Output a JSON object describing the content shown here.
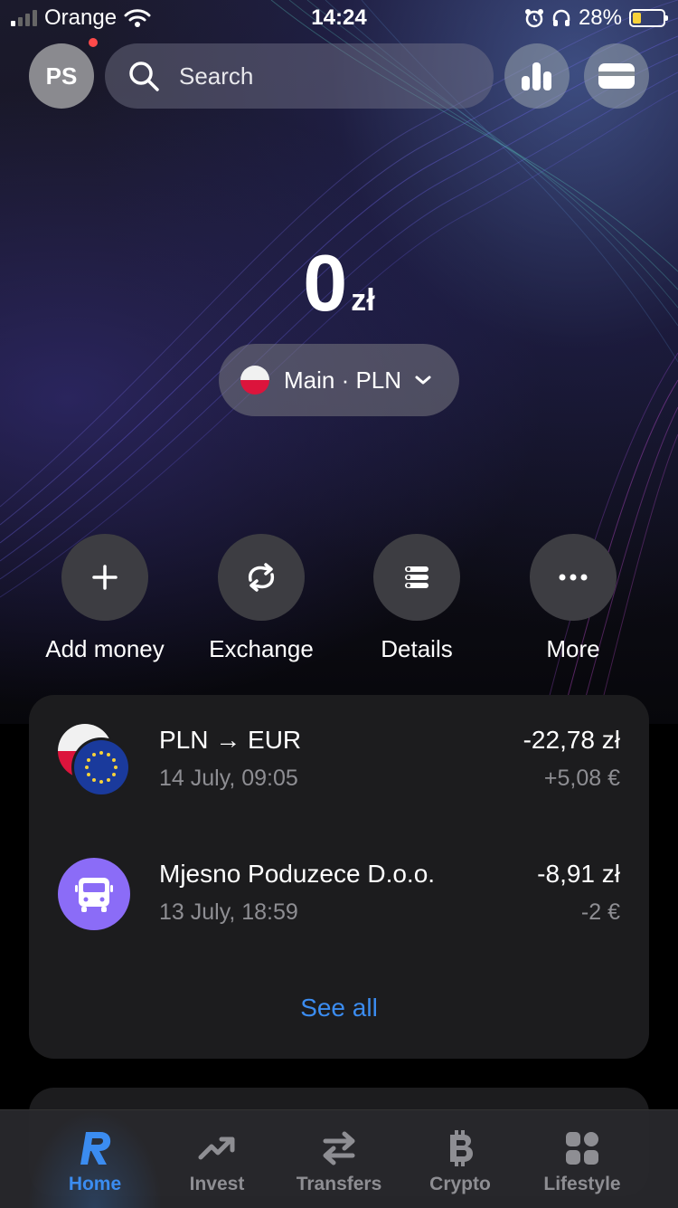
{
  "status_bar": {
    "carrier": "Orange",
    "time": "14:24",
    "battery": "28%",
    "icons": [
      "signal-icon",
      "wifi-icon",
      "alarm-icon",
      "headphones-icon",
      "battery-icon"
    ]
  },
  "header": {
    "avatar_initials": "PS",
    "search_placeholder": "Search"
  },
  "balance": {
    "amount": "0",
    "currency": "zł"
  },
  "account": {
    "label": "Main · PLN"
  },
  "actions": [
    {
      "label": "Add money",
      "icon": "plus-icon"
    },
    {
      "label": "Exchange",
      "icon": "exchange-icon"
    },
    {
      "label": "Details",
      "icon": "details-icon"
    },
    {
      "label": "More",
      "icon": "more-icon"
    }
  ],
  "transactions": [
    {
      "title": "PLN → EUR",
      "date": "14 July, 09:05",
      "amount": "-22,78 zł",
      "secondary_amount": "+5,08 €",
      "icon": "pln-eur-flags-icon"
    },
    {
      "title": "Mjesno Poduzece D.o.o.",
      "date": "13 July, 18:59",
      "amount": "-8,91 zł",
      "secondary_amount": "-2 €",
      "icon": "bus-icon"
    }
  ],
  "see_all": "See all",
  "nav": [
    {
      "label": "Home",
      "active": true
    },
    {
      "label": "Invest",
      "active": false
    },
    {
      "label": "Transfers",
      "active": false
    },
    {
      "label": "Crypto",
      "active": false
    },
    {
      "label": "Lifestyle",
      "active": false
    }
  ],
  "colors": {
    "accent": "#3b8cf0",
    "card_bg": "#1c1c1e",
    "bus_icon_bg": "#8b6cf7"
  }
}
